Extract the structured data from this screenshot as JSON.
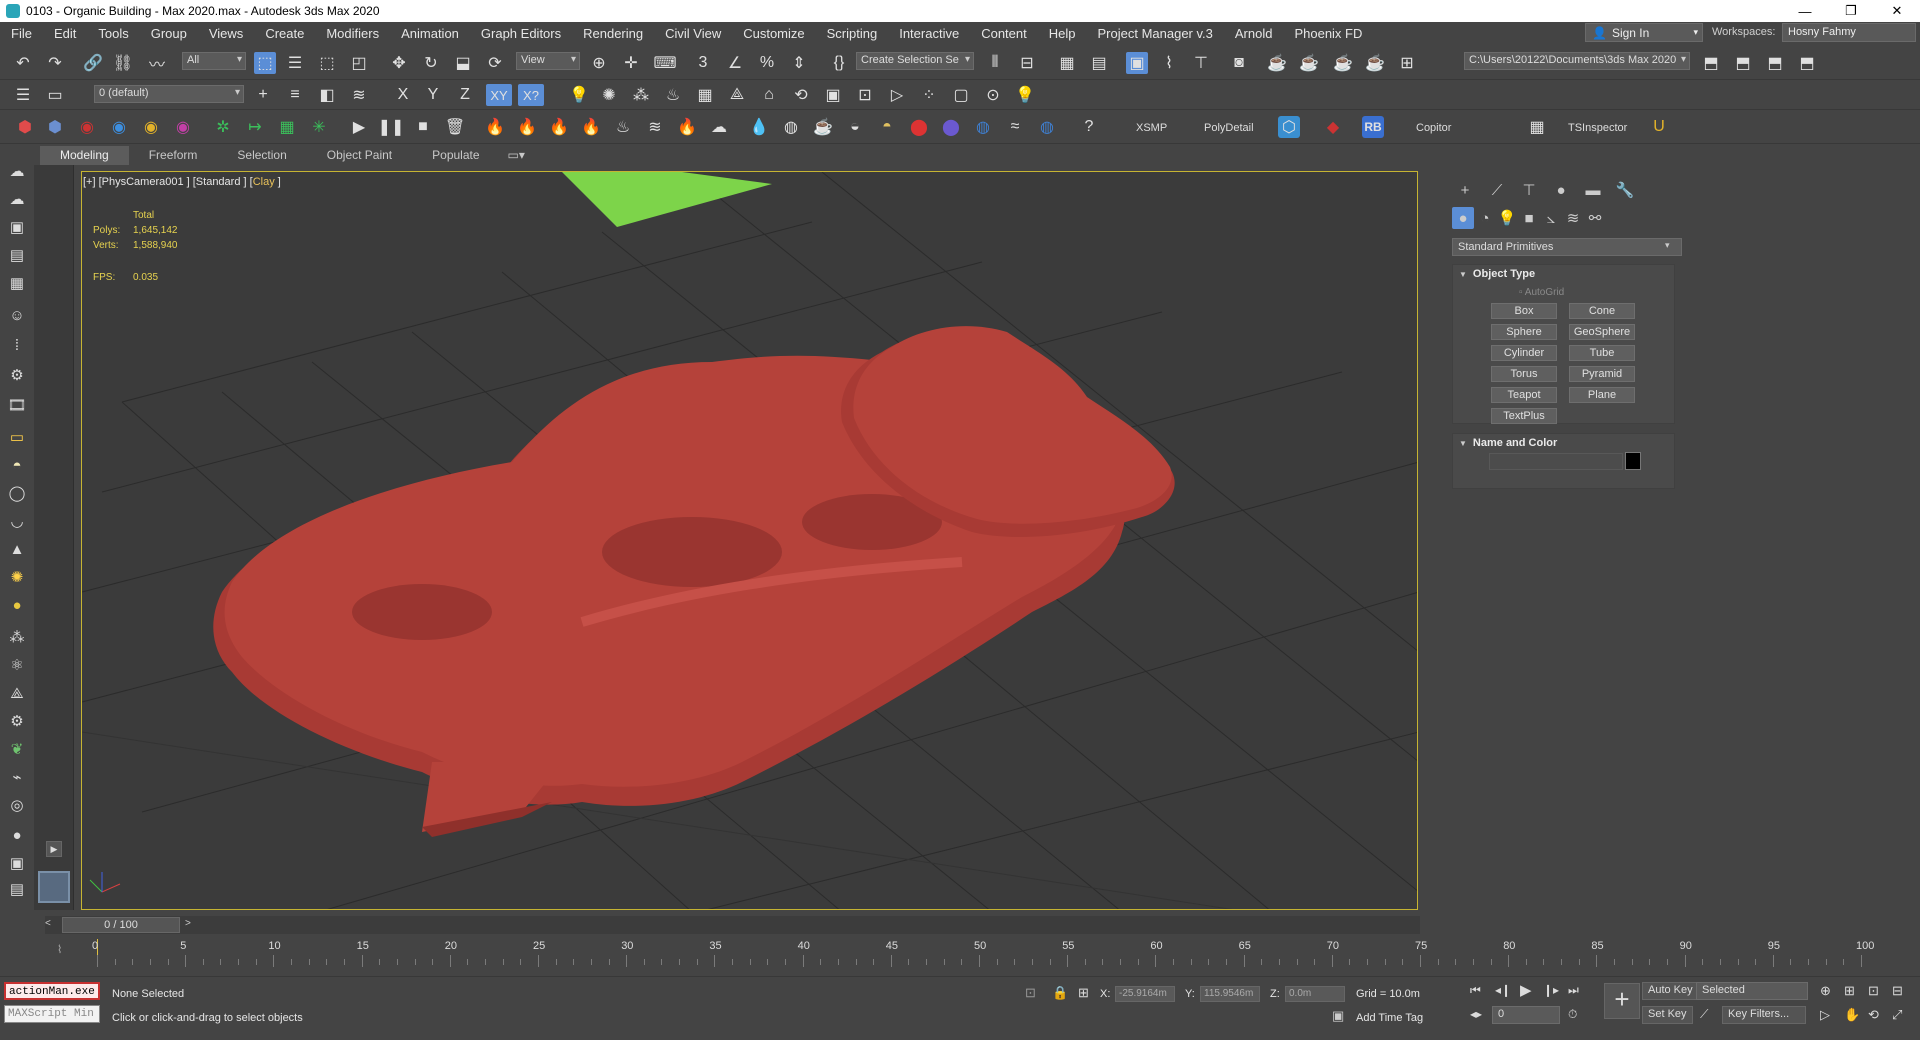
{
  "window": {
    "title": "0103 - Organic Building - Max 2020.max - Autodesk 3ds Max 2020",
    "minimize": "—",
    "restore": "❐",
    "close": "✕"
  },
  "menu": [
    "File",
    "Edit",
    "Tools",
    "Group",
    "Views",
    "Create",
    "Modifiers",
    "Animation",
    "Graph Editors",
    "Rendering",
    "Civil View",
    "Customize",
    "Scripting",
    "Interactive",
    "Content",
    "Help",
    "Project Manager v.3",
    "Arnold",
    "Phoenix FD"
  ],
  "account": {
    "signin": "Sign In",
    "workspaces_label": "Workspaces:",
    "workspace": "Hosny Fahmy"
  },
  "main_toolbar": {
    "selection_filter": "All",
    "ref_coord": "View",
    "named_selection": "Create Selection Se",
    "project_path": "C:\\Users\\20122\\Documents\\3ds Max 2020"
  },
  "layer_toolbar": {
    "layer": "0 (default)",
    "axis_x": "X",
    "axis_y": "Y",
    "axis_z": "Z",
    "axis_xy": "XY",
    "axis_xyz": "X?"
  },
  "plugin_toolbar": {
    "xsmp": "XSMP",
    "polydetail": "PolyDetail",
    "rb": "RB",
    "copitor": "Copitor",
    "tsinspector": "TSInspector"
  },
  "ribbon_tabs": [
    "Modeling",
    "Freeform",
    "Selection",
    "Object Paint",
    "Populate"
  ],
  "viewport": {
    "label_prefix": "[+] [PhysCamera001 ] [Standard ] [",
    "label_shading": "Clay",
    "label_suffix": " ]",
    "stats_total": "Total",
    "polys_label": "Polys:",
    "polys_value": "1,645,142",
    "verts_label": "Verts:",
    "verts_value": "1,588,940",
    "fps_label": "FPS:",
    "fps_value": "0.035",
    "colors": {
      "model": "#b5423a",
      "ground_plane": "#7dd44a",
      "grid": "#2a2a2a",
      "border": "#c6b432"
    }
  },
  "command_panel": {
    "category": "Standard Primitives",
    "object_type_title": "Object Type",
    "autogrid": "AutoGrid",
    "primitives": [
      "Box",
      "Cone",
      "Sphere",
      "GeoSphere",
      "Cylinder",
      "Tube",
      "Torus",
      "Pyramid",
      "Teapot",
      "Plane",
      "TextPlus"
    ],
    "name_color_title": "Name and Color"
  },
  "timeline": {
    "frame_display": "0 / 100",
    "tick_labels": [
      "0",
      "5",
      "10",
      "15",
      "20",
      "25",
      "30",
      "35",
      "40",
      "45",
      "50",
      "55",
      "60",
      "65",
      "70",
      "75",
      "80",
      "85",
      "90",
      "95",
      "100"
    ]
  },
  "status": {
    "maxscript_1": "actionMan.exe",
    "maxscript_2": "MAXScript Min",
    "selection_status": "None Selected",
    "prompt": "Click or click-and-drag to select objects",
    "x_label": "X:",
    "x_value": "-25.9164m",
    "y_label": "Y:",
    "y_value": "115.9546m",
    "z_label": "Z:",
    "z_value": "0.0m",
    "grid": "Grid = 10.0m",
    "add_time_tag": "Add Time Tag",
    "auto_key": "Auto Key",
    "set_key": "Set Key",
    "key_mode": "Selected",
    "current_frame": "0",
    "key_filters": "Key Filters..."
  }
}
